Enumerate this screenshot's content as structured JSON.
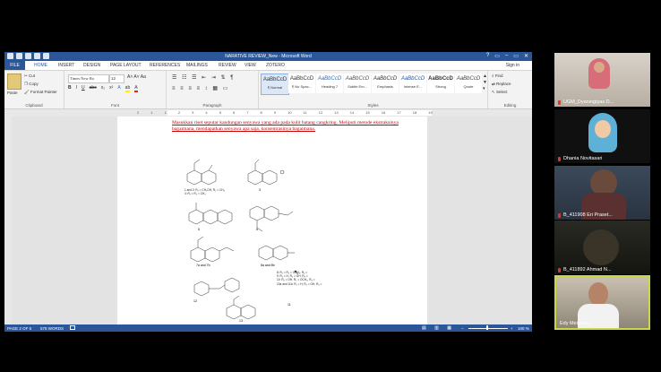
{
  "word": {
    "title": "NARATIVE REVIEW_New - Microsoft Word",
    "window_controls": [
      "?",
      "▭",
      "–",
      "▭",
      "✕"
    ],
    "tabs": [
      "FILE",
      "HOME",
      "INSERT",
      "DESIGN",
      "PAGE LAYOUT",
      "REFERENCES",
      "MAILINGS",
      "REVIEW",
      "VIEW",
      "ZOTERO"
    ],
    "signin": "Sign in",
    "ribbon": {
      "clipboard": {
        "paste": "Paste",
        "cut": "Cut",
        "copy": "Copy",
        "format_painter": "Format Painter",
        "label": "Clipboard"
      },
      "font": {
        "name": "Times New Ro",
        "size": "12",
        "label": "Font",
        "buttons": [
          "B",
          "I",
          "U",
          "abc",
          "x₂",
          "x²"
        ]
      },
      "paragraph": {
        "label": "Paragraph"
      },
      "styles": {
        "label": "Styles",
        "items": [
          {
            "sample": "AaBbCcD",
            "name": "¶ Normal"
          },
          {
            "sample": "AaBbCcD",
            "name": "¶ No Spac..."
          },
          {
            "sample": "AaBbCcD",
            "name": "Heading 7"
          },
          {
            "sample": "AaBbCcD",
            "name": "Subtle Em..."
          },
          {
            "sample": "AaBbCcD",
            "name": "Emphasis"
          },
          {
            "sample": "AaBbCcD",
            "name": "Intense E..."
          },
          {
            "sample": "AaBbCcD",
            "name": "Strong"
          },
          {
            "sample": "AaBbCcD",
            "name": "Quote"
          }
        ]
      },
      "editing": {
        "find": "Find",
        "replace": "Replace",
        "select": "Select",
        "label": "Editing"
      }
    },
    "ruler_numbers": [
      "2",
      "1",
      "1",
      "2",
      "3",
      "4",
      "5",
      "6",
      "7",
      "8",
      "9",
      "10",
      "11",
      "12",
      "13",
      "14",
      "15",
      "16",
      "17",
      "18",
      "19"
    ],
    "paragraph_text": "Masukkan riset seputar kandungan senyawa yang ada pada kulit batang cangkring. Meliputi metode ekstraksinya bagaimana, mendapatkan senyawa apa saja, konsentrasinya bagaimana.",
    "structure_labels": {
      "s1": "1 and 2: R₁ = CH₂OH, R₂ = CH₃",
      "s1b": "4: R₁ = R₂ = CH₃",
      "s3": "3",
      "s5": "5",
      "s6": "6",
      "s7": "7a and 7b",
      "s8": "8a and 8b",
      "s9": "8: R₁ = R₂ = OCH₃, R₃ =",
      "s9b": "9: R₁ = H, R₂ = OH, R₃ =",
      "s10": "10: R₁ = OH, R₂ = OCH₃, R₃ =",
      "s10b": "10a and 11b: R₁ = H, R₂ = OH, R₃ =",
      "s11": "11",
      "s12": "12",
      "s13": "13"
    },
    "status": {
      "page": "PAGE 2 OF 5",
      "words": "578 WORDS",
      "zoom": "100 %"
    }
  },
  "participants": [
    {
      "name": "UGM_Dyaningtyas D..."
    },
    {
      "name": "Dhania Novitasari"
    },
    {
      "name": "B_411908 Eri Praset..."
    },
    {
      "name": "B_411892 Ahmad N..."
    },
    {
      "name": "Edy Meiyanto"
    }
  ],
  "colors": {
    "word_blue": "#2b579a",
    "active_speaker": "#c8d84a",
    "comment_red": "#cc0000"
  }
}
